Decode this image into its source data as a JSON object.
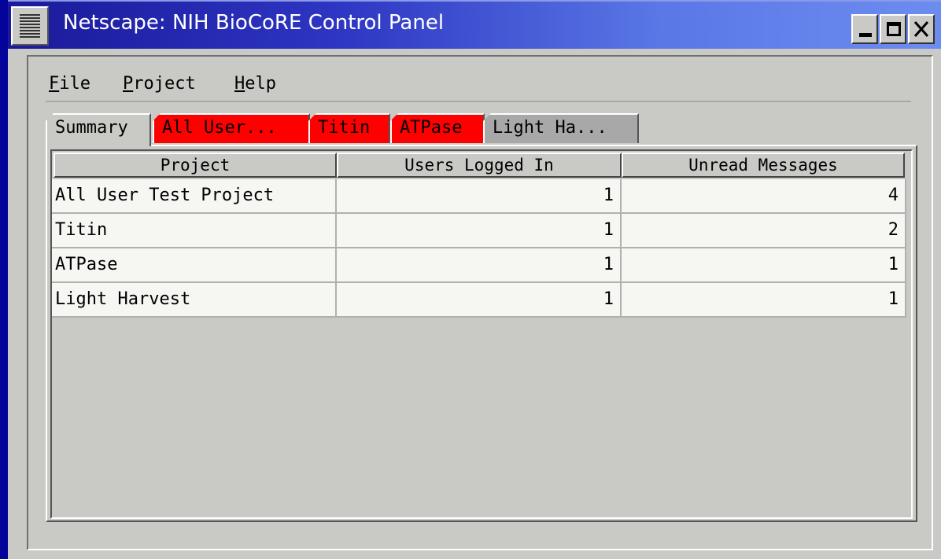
{
  "window": {
    "title": "Netscape: NIH BioCoRE Control Panel",
    "minimize": "minimize-icon",
    "maximize": "maximize-icon",
    "close": "close-icon"
  },
  "menubar": {
    "items": [
      {
        "label": "File",
        "mnemonic": "F",
        "rest": "ile"
      },
      {
        "label": "Project",
        "mnemonic": "P",
        "rest": "roject"
      },
      {
        "label": "Help",
        "mnemonic": "H",
        "rest": "elp"
      }
    ]
  },
  "tabs": [
    {
      "label": "Summary",
      "state": "active"
    },
    {
      "label": "All User...",
      "state": "alert"
    },
    {
      "label": "Titin",
      "state": "alert"
    },
    {
      "label": "ATPase",
      "state": "alert"
    },
    {
      "label": "Light Ha...",
      "state": "normal"
    }
  ],
  "colors": {
    "alert_tab": "#ff0000",
    "normal_tab": "#a8a8a8",
    "desktop": "#04049a"
  },
  "table": {
    "columns": [
      "Project",
      "Users Logged In",
      "Unread Messages"
    ],
    "rows": [
      {
        "project": "All User Test Project",
        "users": "1",
        "unread": "4"
      },
      {
        "project": "Titin",
        "users": "1",
        "unread": "2"
      },
      {
        "project": "ATPase",
        "users": "1",
        "unread": "1"
      },
      {
        "project": "Light Harvest",
        "users": "1",
        "unread": "1"
      }
    ]
  }
}
